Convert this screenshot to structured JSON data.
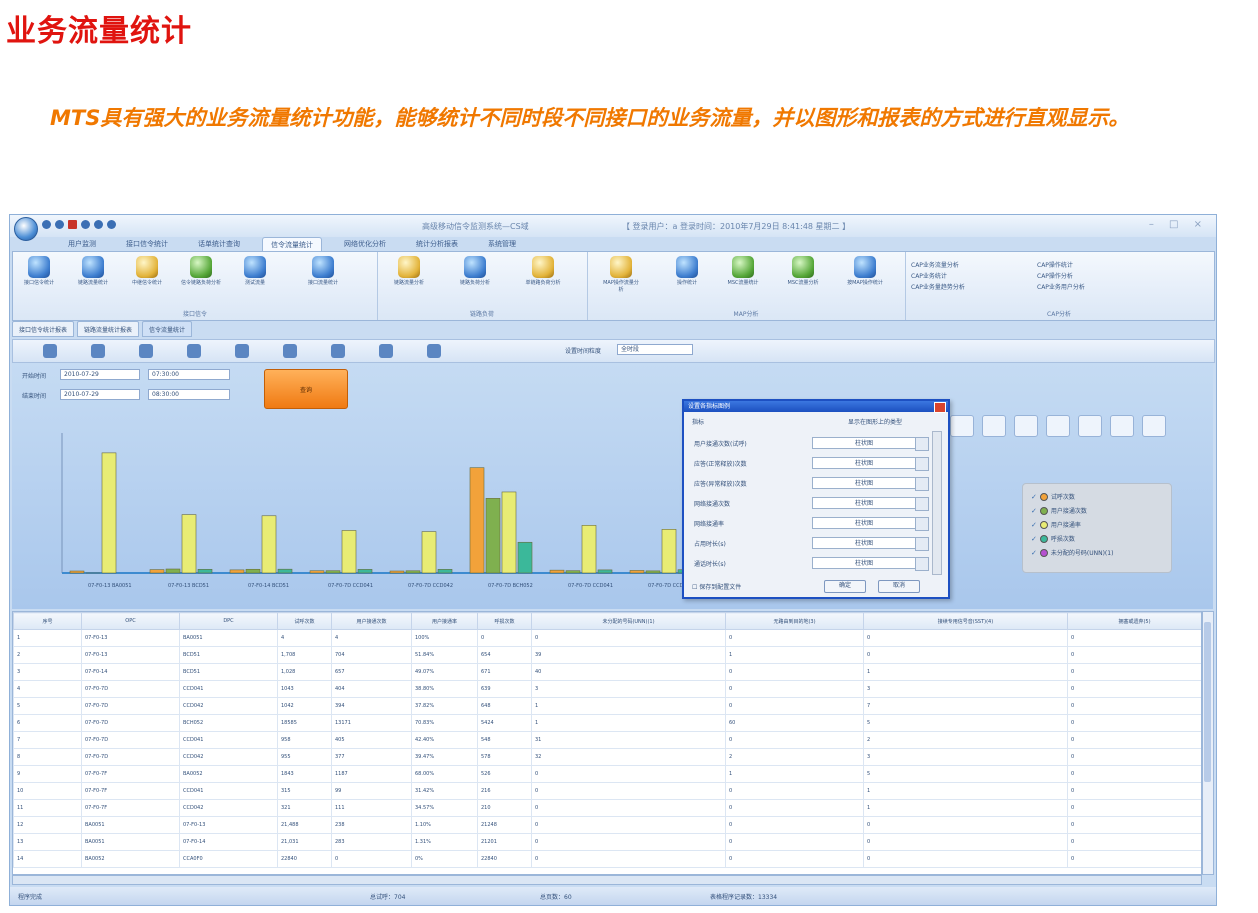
{
  "heading": "业务流量统计",
  "intro": "MTS具有强大的业务流量统计功能，能够统计不同时段不同接口的业务流量，并以图形和报表的方式进行直观显示。",
  "app": {
    "title": "高级移动信令监测系统—CS域",
    "session_info": "【 登录用户：a 登录时间：2010年7月29日 8:41:48 星期二 】",
    "ribbon_tabs": [
      "用户监测",
      "接口信令统计",
      "话单统计查询",
      "信令流量统计",
      "网络优化分析",
      "统计分析报表",
      "系统管理"
    ],
    "active_tab_index": 3,
    "ribbon_groups": [
      {
        "title": "接口信令",
        "buttons": [
          "接口信令统计",
          "链路流量统计",
          "中继信令统计",
          "信令链路负荷分析",
          "测试流量",
          "接口流量统计"
        ]
      },
      {
        "title": "链路负荷",
        "buttons": [
          "链路流量分析",
          "链路负荷分析",
          "单链路负荷分析"
        ]
      },
      {
        "title": "MAP分析",
        "buttons": [
          "MAP操作流量分析",
          "操作统计",
          "MSC流量统计",
          "MSC流量分析",
          "按MAP操作统计"
        ]
      },
      {
        "title": "CAP分析",
        "buttons": [
          "CAP业务流量分析",
          "CAP业务统计",
          "CAP业务量趋势分析",
          "CAP操作统计",
          "CAP操作分析",
          "CAP业务用户分析"
        ]
      }
    ],
    "doc_tabs": [
      "接口信令统计报表",
      "链路流量统计报表",
      "信令流量统计"
    ],
    "toolbar": {
      "period_label": "设置时间粒度",
      "period_value": "全时段"
    },
    "filters": {
      "start_label": "开始时间",
      "start_date": "2010-07-29",
      "start_time": "07:30:00",
      "end_label": "结束时间",
      "end_date": "2010-07-29",
      "end_time": "08:30:00",
      "query_button": "查询"
    },
    "dialog": {
      "title": "设置各指标图例",
      "header_left": "指标",
      "header_right": "显示在图形上的类型",
      "rows": [
        {
          "label": "用户接通次数(试呼)",
          "value": "柱状图"
        },
        {
          "label": "应答(正常释放)次数",
          "value": "柱状图"
        },
        {
          "label": "应答(异常释放)次数",
          "value": "柱状图"
        },
        {
          "label": "网络接通次数",
          "value": "柱状图"
        },
        {
          "label": "网络接通率",
          "value": "柱状图"
        },
        {
          "label": "占用时长(s)",
          "value": "柱状图"
        },
        {
          "label": "通话时长(s)",
          "value": "柱状图"
        }
      ],
      "checkbox_label": "保存到配置文件",
      "ok": "确定",
      "cancel": "取消"
    },
    "legend": [
      "试呼次数",
      "用户接通次数",
      "用户接通率",
      "呼损次数",
      "未分配的号码(UNN)(1)"
    ],
    "table": {
      "columns": [
        "序号",
        "OPC",
        "DPC",
        "试呼次数",
        "用户接通次数",
        "用户接通率",
        "呼损次数",
        "未分配的号码(UNN)(1)",
        "无路由到目的地(3)",
        "接续专用信号音(SST)(4)",
        "拥塞或遗弃(5)"
      ],
      "rows": [
        [
          "1",
          "07-F0-13",
          "BA0051",
          "4",
          "4",
          "100%",
          "0",
          "0",
          "0",
          "0",
          "0"
        ],
        [
          "2",
          "07-F0-13",
          "BCD51",
          "1,708",
          "704",
          "51.84%",
          "654",
          "39",
          "1",
          "0",
          "0"
        ],
        [
          "3",
          "07-F0-14",
          "BCD51",
          "1,028",
          "657",
          "49.07%",
          "671",
          "40",
          "0",
          "1",
          "0"
        ],
        [
          "4",
          "07-F0-7D",
          "CCD041",
          "1043",
          "404",
          "38.80%",
          "639",
          "3",
          "0",
          "3",
          "0"
        ],
        [
          "5",
          "07-F0-7D",
          "CCD042",
          "1042",
          "394",
          "37.82%",
          "648",
          "1",
          "0",
          "7",
          "0"
        ],
        [
          "6",
          "07-F0-7D",
          "BCH052",
          "18585",
          "13171",
          "70.83%",
          "5424",
          "1",
          "60",
          "5",
          "0"
        ],
        [
          "7",
          "07-F0-7D",
          "CCD041",
          "958",
          "405",
          "42.40%",
          "548",
          "31",
          "0",
          "2",
          "0"
        ],
        [
          "8",
          "07-F0-7D",
          "CCD042",
          "955",
          "377",
          "39.47%",
          "578",
          "32",
          "2",
          "3",
          "0"
        ],
        [
          "9",
          "07-F0-7F",
          "BA0052",
          "1843",
          "1187",
          "68.00%",
          "526",
          "0",
          "1",
          "5",
          "0"
        ],
        [
          "10",
          "07-F0-7F",
          "CCD041",
          "315",
          "99",
          "31.42%",
          "216",
          "0",
          "0",
          "1",
          "0"
        ],
        [
          "11",
          "07-F0-7F",
          "CCD042",
          "321",
          "111",
          "34.57%",
          "210",
          "0",
          "0",
          "1",
          "0"
        ],
        [
          "12",
          "BA0051",
          "07-F0-13",
          "21,488",
          "238",
          "1.10%",
          "21248",
          "0",
          "0",
          "0",
          "0"
        ],
        [
          "13",
          "BA0051",
          "07-F0-14",
          "21,031",
          "283",
          "1.31%",
          "21201",
          "0",
          "0",
          "0",
          "0"
        ],
        [
          "14",
          "BA0052",
          "CCA0F0",
          "22840",
          "0",
          "0%",
          "22840",
          "0",
          "0",
          "0",
          "0"
        ]
      ]
    },
    "status": {
      "left": "程序完成",
      "total_calls": "总试呼：704",
      "total_pages": "总页数：60",
      "records": "表格程序记录数：13334"
    }
  },
  "chart_data": {
    "type": "bar",
    "categories": [
      "07-F0-13 BA0051",
      "07-F0-13 BCD51",
      "07-F0-14 BCD51",
      "07-F0-7D CCD041",
      "07-F0-7D CCD042",
      "07-F0-7D BCH052",
      "07-F0-7D CCD041",
      "07-F0-7D CCD042"
    ],
    "series": [
      {
        "name": "试呼次数",
        "color": "#f2a23a",
        "values": [
          350,
          600,
          550,
          400,
          350,
          18585,
          500,
          450
        ]
      },
      {
        "name": "用户接通次数",
        "color": "#7fb04f",
        "values": [
          4,
          704,
          657,
          404,
          394,
          13171,
          405,
          377
        ]
      },
      {
        "name": "用户接通率",
        "color": "#e8ec74",
        "values": [
          21200,
          10300,
          10100,
          7500,
          7300,
          14300,
          8400,
          7700
        ]
      },
      {
        "name": "呼损次数",
        "color": "#3bb89a",
        "values": [
          0,
          654,
          671,
          639,
          648,
          5424,
          548,
          578
        ]
      }
    ],
    "ylim": [
      0,
      24000
    ]
  }
}
